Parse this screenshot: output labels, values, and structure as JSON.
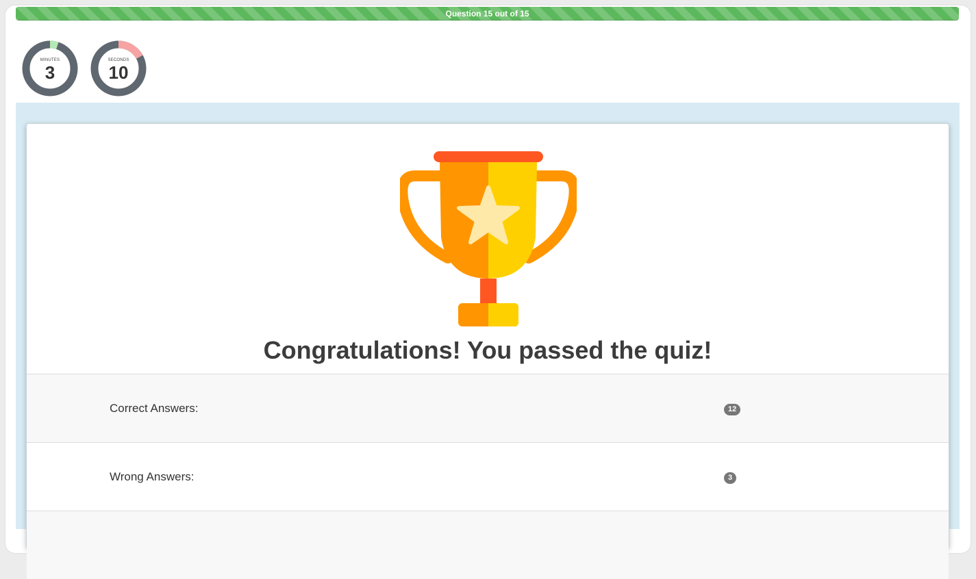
{
  "progress": {
    "label": "Question 15 out of 15",
    "fraction": 1.0,
    "color": "#5cb85c"
  },
  "timers": [
    {
      "caption": "MINUTES",
      "value": "3",
      "fraction": 0.05,
      "arc_color": "#b5e9b5"
    },
    {
      "caption": "SECONDS",
      "value": "10",
      "fraction": 0.17,
      "arc_color": "#f5a3a3"
    }
  ],
  "result": {
    "icon": "trophy-icon",
    "title": "Congratulations! You passed the quiz!"
  },
  "stats": [
    {
      "label": "Correct Answers:",
      "value": "12"
    },
    {
      "label": "Wrong Answers:",
      "value": "3"
    }
  ],
  "colors": {
    "stage_bg": "#d8ebf4",
    "ring": "#5f6770",
    "badge": "#777777",
    "trophy_orange": "#ff9500",
    "trophy_yellow": "#ffd000",
    "trophy_red": "#ff5722"
  }
}
